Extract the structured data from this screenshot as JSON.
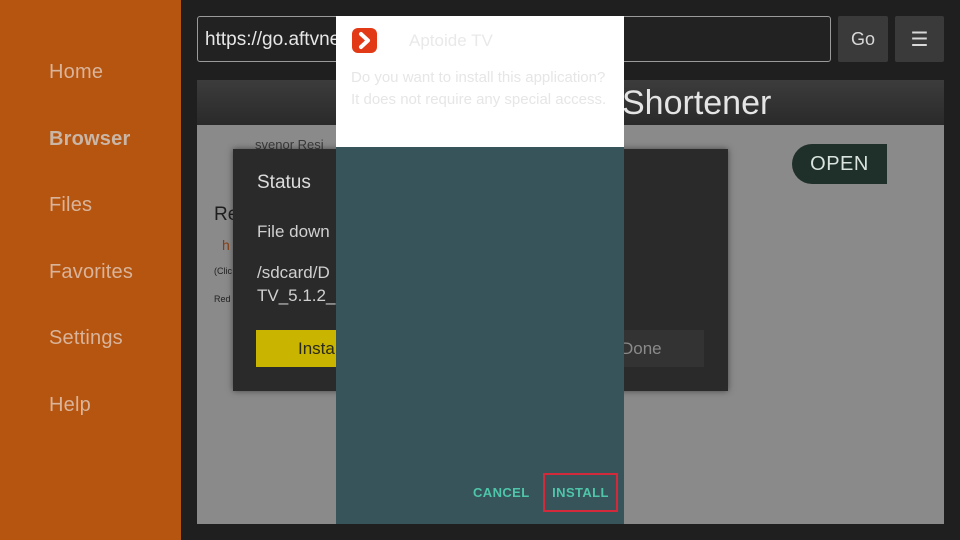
{
  "sidebar": {
    "items": [
      {
        "label": "Home"
      },
      {
        "label": "Browser"
      },
      {
        "label": "Files"
      },
      {
        "label": "Favorites"
      },
      {
        "label": "Settings"
      },
      {
        "label": "Help"
      }
    ],
    "active": "Browser"
  },
  "address_bar": {
    "url": "https://go.aftvnews.com/",
    "go_label": "Go",
    "menu_icon": "☰"
  },
  "page": {
    "title": "Shortener",
    "open_label": "OPEN",
    "text_1": "svenor Resi",
    "text_2": "Re",
    "text_3": "h",
    "text_4": "(Clic",
    "text_5": "Red"
  },
  "status_dialog": {
    "title": "Status",
    "message": "File down",
    "path_line_1": "/sdcard/D",
    "path_line_2": "TV_5.1.2_",
    "install_label": "Insta",
    "done_label": "Done"
  },
  "installer": {
    "app_name": "Aptoide TV",
    "prompt": "Do you want to install this application? It does not require any special access.",
    "cancel_label": "CANCEL",
    "install_label": "INSTALL"
  },
  "colors": {
    "sidebar_bg": "#b55510",
    "installer_accent": "#4fc5a9",
    "highlight_border": "#d22a3a",
    "install_yellow": "#c9b400"
  }
}
